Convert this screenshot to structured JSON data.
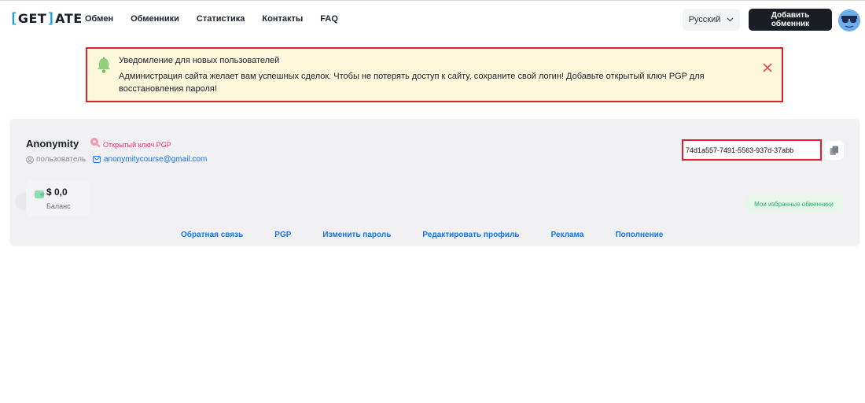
{
  "header": {
    "logo": {
      "left": "GET",
      "right": "ATE"
    },
    "nav": [
      "Обмен",
      "Обменники",
      "Статистика",
      "Контакты",
      "FAQ"
    ],
    "language": "Русский",
    "add_button": "Добавить обменник"
  },
  "notice": {
    "title": "Уведомление для новых пользователей",
    "message": "Администрация сайта желает вам успешных сделок. Чтобы не потерять доступ к сайту, сохраните свой логин! Добавьте открытый ключ PGP для восстановления пароля!"
  },
  "profile": {
    "username": "Anonymity",
    "pgp_link": "Открытый ключ PGP",
    "role": "пользователь",
    "email": "anonymitycourse@gmail.com",
    "login_key": "74d1a557-7491-5563-937d-37abb",
    "balance_value": "$ 0,0",
    "balance_label": "Баланс",
    "favorites_badge": "Мои избранные обменники",
    "links": [
      "Обратная связь",
      "PGP",
      "Изменить пароль",
      "Редактировать профиль",
      "Реклама",
      "Пополнение"
    ]
  },
  "colors": {
    "accent": "#1aa3d9",
    "link": "#1a73e8",
    "alert_border": "#e01f2d",
    "pgp": "#e8336b",
    "success": "#2bb36a"
  }
}
